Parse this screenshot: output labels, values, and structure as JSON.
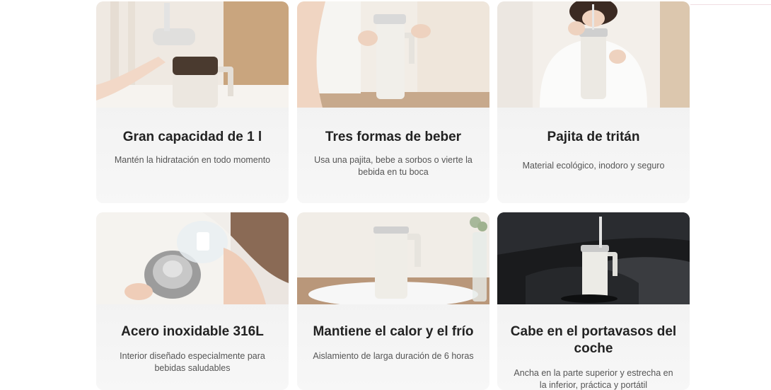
{
  "features": [
    {
      "title": "Gran capacidad de 1 l",
      "description": "Mantén la hidratación en todo momento"
    },
    {
      "title": "Tres formas de beber",
      "description": "Usa una pajita, bebe a sorbos o vierte la bebida en tu boca"
    },
    {
      "title": "Pajita de tritán",
      "description": "Material ecológico, inodoro y seguro"
    },
    {
      "title": "Acero inoxidable 316L",
      "description": "Interior diseñado especialmente para bebidas saludables"
    },
    {
      "title": "Mantiene el calor y el frío",
      "description": "Aislamiento de larga duración de 6 horas"
    },
    {
      "title": "Cabe en el portavasos del coche",
      "description": "Ancha en la parte superior y estrecha en la inferior, práctica y portátil"
    }
  ]
}
